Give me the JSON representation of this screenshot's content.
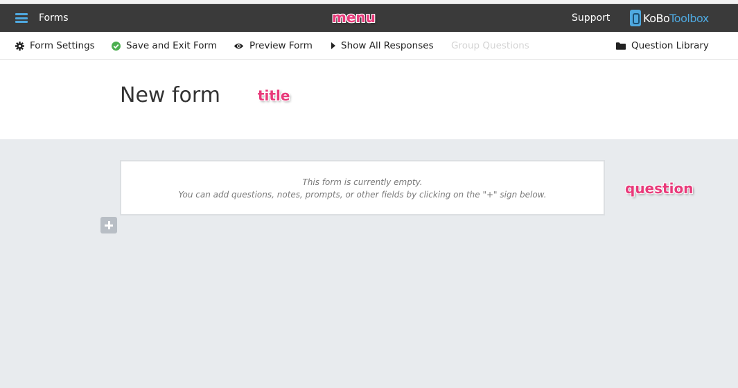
{
  "topbar": {
    "menu_icon": "hamburger-menu-icon",
    "title": "Forms",
    "support_label": "Support",
    "logo": {
      "part1": "KoBo",
      "part2": "Toolbox",
      "brand_color": "#4fa9e0"
    },
    "background_color": "#3a3a3a"
  },
  "toolbar": {
    "items": [
      {
        "label": "Form Settings",
        "icon": "gear-icon"
      },
      {
        "label": "Save and Exit Form",
        "icon": "check-circle-icon",
        "icon_color": "#4caf50"
      },
      {
        "label": "Preview Form",
        "icon": "eye-icon"
      },
      {
        "label": "Show All Responses",
        "icon": "caret-right-icon"
      },
      {
        "label": "Group Questions",
        "disabled": true
      },
      {
        "label": "Question Library",
        "icon": "folder-icon"
      }
    ]
  },
  "form": {
    "title": "New form",
    "empty_line1": "This form is currently empty.",
    "empty_line2": "You can add questions, notes, prompts, or other fields by clicking on the \"+\" sign below.",
    "add_button_icon": "plus-icon"
  },
  "annotations": {
    "menu": "menu",
    "title": "title",
    "question": "question",
    "color": "#e83a7a"
  }
}
